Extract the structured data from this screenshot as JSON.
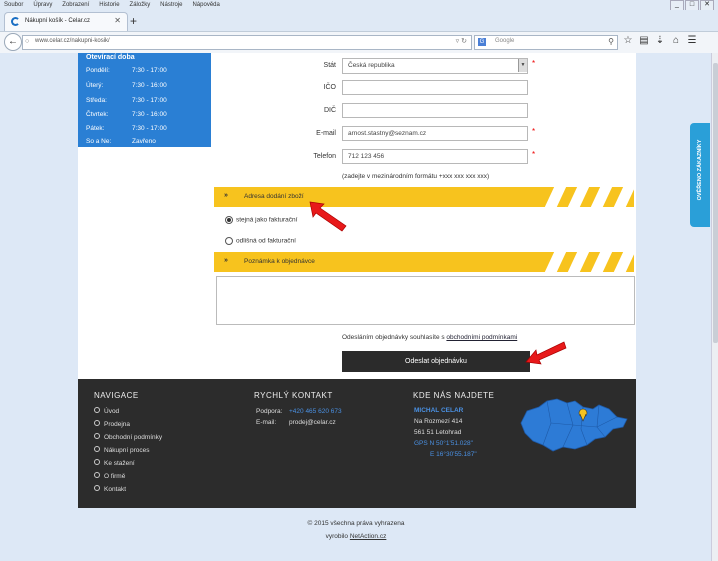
{
  "browser": {
    "menu": [
      "Soubor",
      "Úpravy",
      "Zobrazení",
      "Historie",
      "Záložky",
      "Nástroje",
      "Nápověda"
    ],
    "window_buttons": [
      "_",
      "□",
      "✕"
    ],
    "tab_title": "Nákupní košík - Celar.cz",
    "tab_close": "✕",
    "new_tab": "+",
    "url": "www.celar.cz/nakupni-kosik/",
    "search_placeholder": "Google",
    "search_engine_icon": "G"
  },
  "hours": {
    "title": "Otevírací doba",
    "rows": [
      {
        "day": "Pondělí:",
        "time": "7:30 - 17:00"
      },
      {
        "day": "Úterý:",
        "time": "7:30 - 16:00"
      },
      {
        "day": "Středa:",
        "time": "7:30 - 17:00"
      },
      {
        "day": "Čtvrtek:",
        "time": "7:30 - 16:00"
      },
      {
        "day": "Pátek:",
        "time": "7:30 - 17:00"
      },
      {
        "day": "So a Ne:",
        "time": "Zavřeno"
      }
    ]
  },
  "form": {
    "stat_label": "Stát",
    "stat_value": "Česká republika",
    "ico_label": "IČO",
    "ico_value": "",
    "dic_label": "DIČ",
    "dic_value": "",
    "email_label": "E-mail",
    "email_value": "arnost.stastny@seznam.cz",
    "phone_label": "Telefon",
    "phone_value": "712 123 456",
    "phone_hint": "(zadejte v mezinárodním formátu +xxx xxx xxx xxx)",
    "required_mark": "*"
  },
  "delivery": {
    "chevrons": "»",
    "title": "Adresa dodání zboží",
    "option_same": "stejná jako fakturační",
    "option_diff": "odlišná od fakturační"
  },
  "note": {
    "chevrons": "»",
    "title": "Poznámka k objednávce",
    "value": ""
  },
  "consent": {
    "text": "Odesláním objednávky souhlasíte s ",
    "link": "obchodními podmínkami"
  },
  "submit_label": "Odeslat objednávku",
  "footer": {
    "nav_title": "NAVIGACE",
    "nav_items": [
      "Úvod",
      "Prodejna",
      "Obchodní podmínky",
      "Nákupní proces",
      "Ke stažení",
      "O firmě",
      "Kontakt"
    ],
    "contact_title": "RYCHLÝ KONTAKT",
    "phone_label": "Podpora:",
    "phone_value": "+420 465 620 673",
    "email_label": "E-mail:",
    "email_value": "prodej@celar.cz",
    "find_title": "KDE NÁS NAJDETE",
    "company": "MICHAL CELAR",
    "street": "Na Rozmezí 414",
    "city": "561 51 Letohrad",
    "gps_n": "GPS N 50°1'51.028\"",
    "gps_e": "E 16°30'55.187\""
  },
  "copyright": "© 2015 všechna práva vyhrazena",
  "made_by_prefix": "vyrobilo ",
  "made_by_link": "NetAction.cz",
  "badge": "OVĚŘENO ZÁKAZNÍKY",
  "colors": {
    "accent_blue": "#2a7fd4",
    "accent_yellow": "#f7c31e",
    "footer": "#2c2c2c",
    "required": "#e00000"
  }
}
